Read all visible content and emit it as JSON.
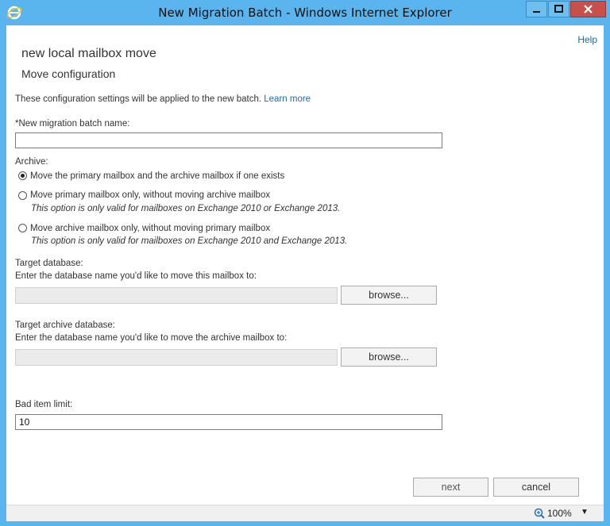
{
  "window": {
    "title": "New Migration Batch - Windows Internet Explorer"
  },
  "header": {
    "help": "Help",
    "heading": "new local mailbox move",
    "subheading": "Move configuration"
  },
  "intro": {
    "text": "These configuration settings will be applied to the new batch.",
    "link": "Learn more"
  },
  "batch_name": {
    "label": "*New migration batch name:",
    "value": ""
  },
  "archive": {
    "label": "Archive:",
    "options": [
      {
        "label": "Move the primary mailbox and the archive mailbox if one exists",
        "note": "",
        "selected": true
      },
      {
        "label": "Move primary mailbox only, without moving archive mailbox",
        "note": "This option is only valid for mailboxes on Exchange 2010 or Exchange 2013.",
        "selected": false
      },
      {
        "label": "Move archive mailbox only, without moving primary mailbox",
        "note": "This option is only valid for mailboxes on Exchange 2010 and Exchange 2013.",
        "selected": false
      }
    ]
  },
  "target_db": {
    "label": "Target database:",
    "hint": "Enter the database name you'd like to move this mailbox to:",
    "browse": "browse..."
  },
  "target_archive_db": {
    "label": "Target archive database:",
    "hint": "Enter the database name you'd like to move the archive mailbox to:",
    "browse": "browse..."
  },
  "bad_item": {
    "label": "Bad item limit:",
    "value": "10"
  },
  "footer": {
    "next": "next",
    "cancel": "cancel"
  },
  "statusbar": {
    "zoom": "100%"
  },
  "colors": {
    "titlebar": "#5ab4ee",
    "link": "#1f6aa8",
    "close": "#c7504b"
  }
}
